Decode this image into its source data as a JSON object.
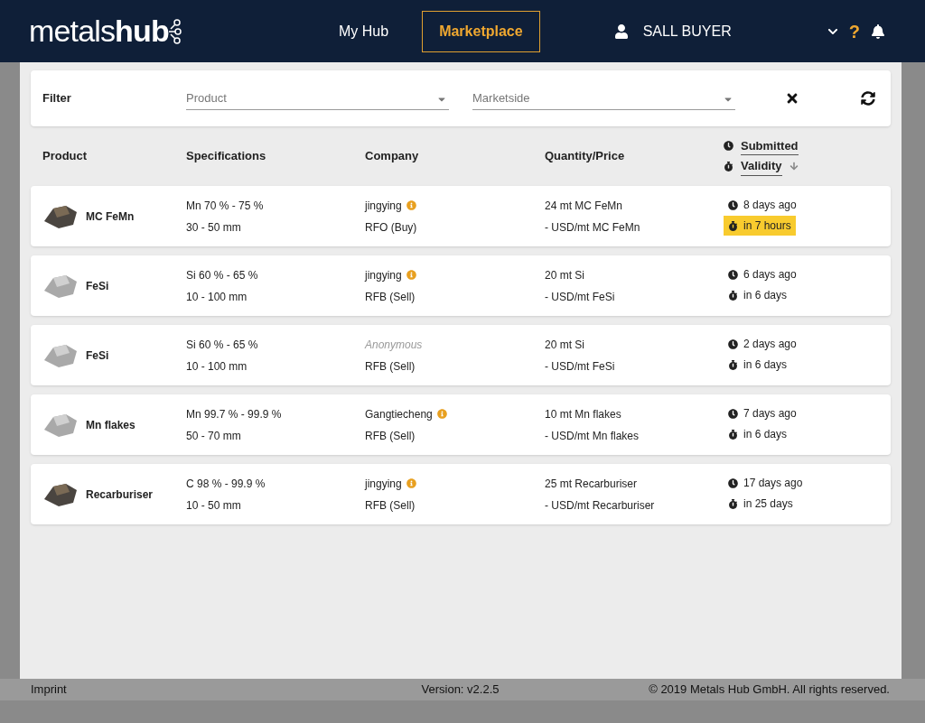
{
  "header": {
    "logo_light": "metals",
    "logo_bold": "hub",
    "nav": [
      {
        "label": "My Hub",
        "selected": false
      },
      {
        "label": "Marketplace",
        "selected": true
      }
    ],
    "user": "SALL BUYER",
    "help": "?"
  },
  "filter": {
    "label": "Filter",
    "fields": [
      {
        "placeholder": "Product"
      },
      {
        "placeholder": "Marketside"
      }
    ]
  },
  "table": {
    "columns": [
      "Product",
      "Specifications",
      "Company",
      "Quantity/Price"
    ],
    "sort_columns": [
      {
        "label": "Submitted",
        "sorted": false
      },
      {
        "label": "Validity",
        "sorted": true
      }
    ],
    "rows": [
      {
        "product": "MC FeMn",
        "kind": "dark",
        "spec": [
          "Mn 70 % - 75 %",
          "30 - 50 mm"
        ],
        "company": "jingying",
        "anonymous": false,
        "verified": true,
        "type": "RFO (Buy)",
        "quantity": "24 mt MC FeMn",
        "price": "- USD/mt MC FeMn",
        "submitted": "8 days ago",
        "validity": "in 7 hours",
        "urgent": true
      },
      {
        "product": "FeSi",
        "kind": "light",
        "spec": [
          "Si 60 % - 65 %",
          "10 - 100 mm"
        ],
        "company": "jingying",
        "anonymous": false,
        "verified": true,
        "type": "RFB (Sell)",
        "quantity": "20 mt Si",
        "price": "- USD/mt FeSi",
        "submitted": "6 days ago",
        "validity": "in 6 days",
        "urgent": false
      },
      {
        "product": "FeSi",
        "kind": "light",
        "spec": [
          "Si 60 % - 65 %",
          "10 - 100 mm"
        ],
        "company": "Anonymous",
        "anonymous": true,
        "verified": false,
        "type": "RFB (Sell)",
        "quantity": "20 mt Si",
        "price": "- USD/mt FeSi",
        "submitted": "2 days ago",
        "validity": "in 6 days",
        "urgent": false
      },
      {
        "product": "Mn flakes",
        "kind": "light",
        "spec": [
          "Mn 99.7 % - 99.9 %",
          "50 - 70 mm"
        ],
        "company": "Gangtiecheng",
        "anonymous": false,
        "verified": true,
        "type": "RFB (Sell)",
        "quantity": "10 mt Mn flakes",
        "price": "- USD/mt Mn flakes",
        "submitted": "7 days ago",
        "validity": "in 6 days",
        "urgent": false
      },
      {
        "product": "Recarburiser",
        "kind": "dark",
        "spec": [
          "C 98 % - 99.9 %",
          "10 - 50 mm"
        ],
        "company": "jingying",
        "anonymous": false,
        "verified": true,
        "type": "RFB (Sell)",
        "quantity": "25 mt Recarburiser",
        "price": "- USD/mt Recarburiser",
        "submitted": "17 days ago",
        "validity": "in 25 days",
        "urgent": false
      }
    ]
  },
  "footer": {
    "imprint": "Imprint",
    "version": "Version: v2.2.5",
    "copyright": "© 2019 Metals Hub GmbH. All rights reserved."
  }
}
